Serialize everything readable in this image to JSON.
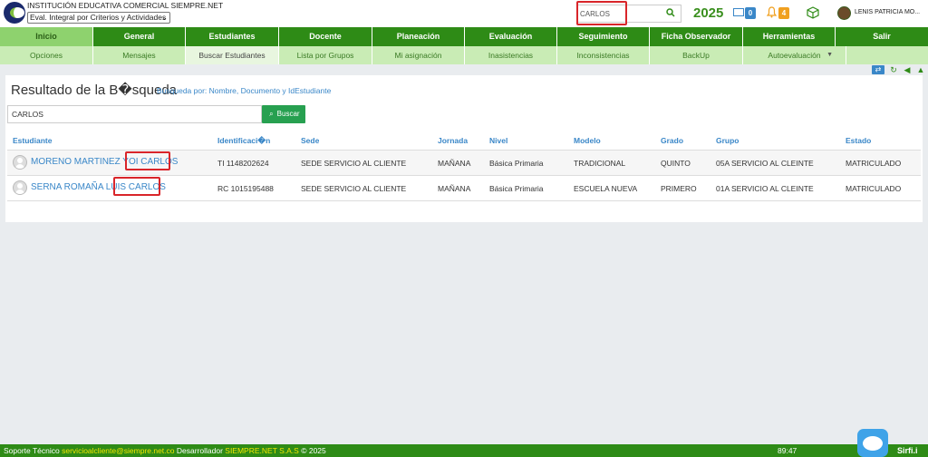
{
  "header": {
    "institution_name": "INSTITUCIÓN EDUCATIVA COMERCIAL SIEMPRE.NET",
    "evaluation_select": "Eval. Integral por Criterios y Actividades",
    "search_value": "CARLOS",
    "year": "2025",
    "messages_count": "0",
    "notifications_count": "4",
    "user_name": "LENIS PATRICIA MO..."
  },
  "nav": {
    "items": [
      "Inicio",
      "General",
      "Estudiantes",
      "Docente",
      "Planeación",
      "Evaluación",
      "Seguimiento",
      "Ficha Observador",
      "Herramientas",
      "Salir"
    ],
    "sub_items": [
      "Opciones",
      "Mensajes",
      "Buscar Estudiantes",
      "Lista por Grupos",
      "Mi asignación",
      "Inasistencias",
      "Inconsistencias",
      "BackUp",
      "Autoevaluación"
    ]
  },
  "results": {
    "title": "Resultado de la B�squeda",
    "subtitle": "Busqueda por: Nombre, Documento y IdEstudiante",
    "search_value": "CARLOS",
    "search_button": "Buscar",
    "columns": [
      "Estudiante",
      "Identificaci�n",
      "Sede",
      "Jornada",
      "Nivel",
      "Modelo",
      "Grado",
      "Grupo",
      "Estado"
    ],
    "rows": [
      {
        "name": "MORENO MARTINEZ YOI CARLOS",
        "id": "TI  1148202624",
        "sede": "SEDE SERVICIO AL CLIENTE",
        "jornada": "MAÑANA",
        "nivel": "Básica Primaria",
        "modelo": "TRADICIONAL",
        "grado": "QUINTO",
        "grupo": "05A SERVICIO AL CLEINTE",
        "estado": "MATRICULADO"
      },
      {
        "name": "SERNA ROMAÑA LUIS CARLOS",
        "id": "RC  1015195488",
        "sede": "SEDE SERVICIO AL CLIENTE",
        "jornada": "MAÑANA",
        "nivel": "Básica Primaria",
        "modelo": "ESCUELA NUEVA",
        "grado": "PRIMERO",
        "grupo": "01A SERVICIO AL CLEINTE",
        "estado": "MATRICULADO"
      }
    ]
  },
  "footer": {
    "support_label": "Soporte Técnico",
    "support_email": "servicioalcliente@siempre.net.co",
    "developer_label": "Desarrollador",
    "developer_name": "SIEMPRE.NET S.A.S",
    "copyright": "© 2025",
    "time": "89:47",
    "brand": "Sirfi.i"
  },
  "colors": {
    "primary_green": "#2e8b16",
    "active_green": "#8ed26e",
    "link_blue": "#3a87c8",
    "highlight_red": "#d9252a"
  }
}
